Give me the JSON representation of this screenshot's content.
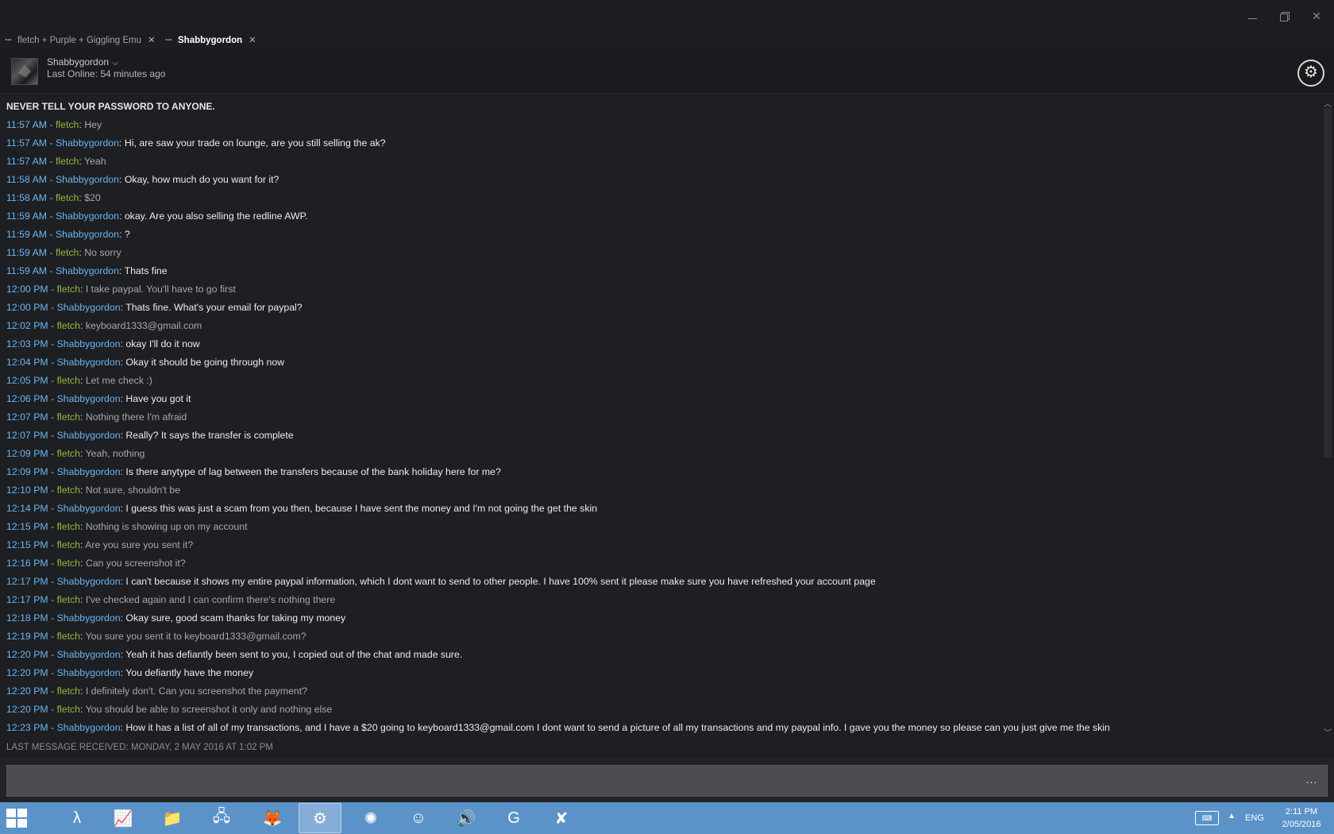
{
  "window": {
    "tabs": [
      {
        "label": "fletch + Purple + Giggling Emu",
        "active": false
      },
      {
        "label": "Shabbygordon",
        "active": true
      }
    ]
  },
  "header": {
    "friend_name": "Shabbygordon",
    "last_online": "Last Online: 54 minutes ago"
  },
  "chat": {
    "warning": "NEVER TELL YOUR PASSWORD TO ANYONE.",
    "separator": " - ",
    "messages": [
      {
        "time": "11:57 AM",
        "sender": "fletch",
        "text": "Hey"
      },
      {
        "time": "11:57 AM",
        "sender": "Shabbygordon",
        "text": "Hi, are saw your trade on lounge, are you still selling the ak?"
      },
      {
        "time": "11:57 AM",
        "sender": "fletch",
        "text": "Yeah"
      },
      {
        "time": "11:58 AM",
        "sender": "Shabbygordon",
        "text": "Okay, how much do you want for it?"
      },
      {
        "time": "11:58 AM",
        "sender": "fletch",
        "text": "$20"
      },
      {
        "time": "11:59 AM",
        "sender": "Shabbygordon",
        "text": "okay. Are you also selling the redline AWP."
      },
      {
        "time": "11:59 AM",
        "sender": "Shabbygordon",
        "text": "?"
      },
      {
        "time": "11:59 AM",
        "sender": "fletch",
        "text": "No sorry"
      },
      {
        "time": "11:59 AM",
        "sender": "Shabbygordon",
        "text": "Thats fine"
      },
      {
        "time": "12:00 PM",
        "sender": "fletch",
        "text": "I take paypal. You'll have to go first"
      },
      {
        "time": "12:00 PM",
        "sender": "Shabbygordon",
        "text": "Thats fine. What's your email for paypal?"
      },
      {
        "time": "12:02 PM",
        "sender": "fletch",
        "text": "keyboard1333@gmail.com"
      },
      {
        "time": "12:03 PM",
        "sender": "Shabbygordon",
        "text": "okay I'll do it now"
      },
      {
        "time": "12:04 PM",
        "sender": "Shabbygordon",
        "text": "Okay it should be going through now"
      },
      {
        "time": "12:05 PM",
        "sender": "fletch",
        "text": "Let me check :)"
      },
      {
        "time": "12:06 PM",
        "sender": "Shabbygordon",
        "text": "Have you got it"
      },
      {
        "time": "12:07 PM",
        "sender": "fletch",
        "text": "Nothing there I'm afraid"
      },
      {
        "time": "12:07 PM",
        "sender": "Shabbygordon",
        "text": "Really? It says the transfer is complete"
      },
      {
        "time": "12:09 PM",
        "sender": "fletch",
        "text": "Yeah, nothing"
      },
      {
        "time": "12:09 PM",
        "sender": "Shabbygordon",
        "text": "Is there anytype of lag between the transfers because of the bank holiday here for me?"
      },
      {
        "time": "12:10 PM",
        "sender": "fletch",
        "text": "Not sure, shouldn't be"
      },
      {
        "time": "12:14 PM",
        "sender": "Shabbygordon",
        "text": "I guess this was just a scam from you then, because I have sent the money and I'm not going the get the skin"
      },
      {
        "time": "12:15 PM",
        "sender": "fletch",
        "text": "Nothing is showing up on my account"
      },
      {
        "time": "12:15 PM",
        "sender": "fletch",
        "text": "Are you sure you sent it?"
      },
      {
        "time": "12:16 PM",
        "sender": "fletch",
        "text": "Can you screenshot it?"
      },
      {
        "time": "12:17 PM",
        "sender": "Shabbygordon",
        "text": "I can't because it shows my entire paypal information, which I dont want to send to other people. I have 100% sent it please make sure you have refreshed your account page"
      },
      {
        "time": "12:17 PM",
        "sender": "fletch",
        "text": "I've checked again and I can confirm there's nothing there"
      },
      {
        "time": "12:18 PM",
        "sender": "Shabbygordon",
        "text": "Okay sure, good scam thanks for taking my money"
      },
      {
        "time": "12:19 PM",
        "sender": "fletch",
        "text": "You sure you sent it to keyboard1333@gmail.com?"
      },
      {
        "time": "12:20 PM",
        "sender": "Shabbygordon",
        "text": "Yeah it has defiantly been sent to you, I copied out of the chat and made sure."
      },
      {
        "time": "12:20 PM",
        "sender": "Shabbygordon",
        "text": "You defiantly have the money"
      },
      {
        "time": "12:20 PM",
        "sender": "fletch",
        "text": "I definitely don't. Can you screenshot the payment?"
      },
      {
        "time": "12:20 PM",
        "sender": "fletch",
        "text": "You should be able to screenshot it only and nothing else"
      },
      {
        "time": "12:23 PM",
        "sender": "Shabbygordon",
        "text": "How it has a list of all of my transactions, and I have a $20 going to keyboard1333@gmail.com I dont want to send a picture of all my transactions and my paypal info. I gave you the money so please can you just give me the skin"
      }
    ],
    "last_message_received": "LAST MESSAGE RECEIVED: MONDAY, 2 MAY 2016 AT 1:02 PM",
    "more_label": "..."
  },
  "colors": {
    "timestamp": "#6ab4f2",
    "fletch_name": "#90ba3c",
    "shabby_name": "#6ab4f2",
    "background": "#1e1f22",
    "taskbar": "#5b93c9"
  },
  "taskbar": {
    "apps": [
      {
        "icon": "lambda-icon",
        "active": false
      },
      {
        "icon": "notepad-chart-icon",
        "active": false
      },
      {
        "icon": "file-explorer-icon",
        "active": false
      },
      {
        "icon": "network-computer-icon",
        "active": false
      },
      {
        "icon": "firefox-icon",
        "active": false
      },
      {
        "icon": "steam-icon",
        "active": true
      },
      {
        "icon": "blue-orb-icon",
        "active": false
      },
      {
        "icon": "discord-icon",
        "active": false
      },
      {
        "icon": "speaker-icon",
        "active": false
      },
      {
        "icon": "logitech-g-icon",
        "active": false
      },
      {
        "icon": "dota-icon",
        "active": false
      }
    ],
    "tray": {
      "language": "ENG",
      "time": "2:11 PM",
      "date": "2/05/2016"
    }
  }
}
